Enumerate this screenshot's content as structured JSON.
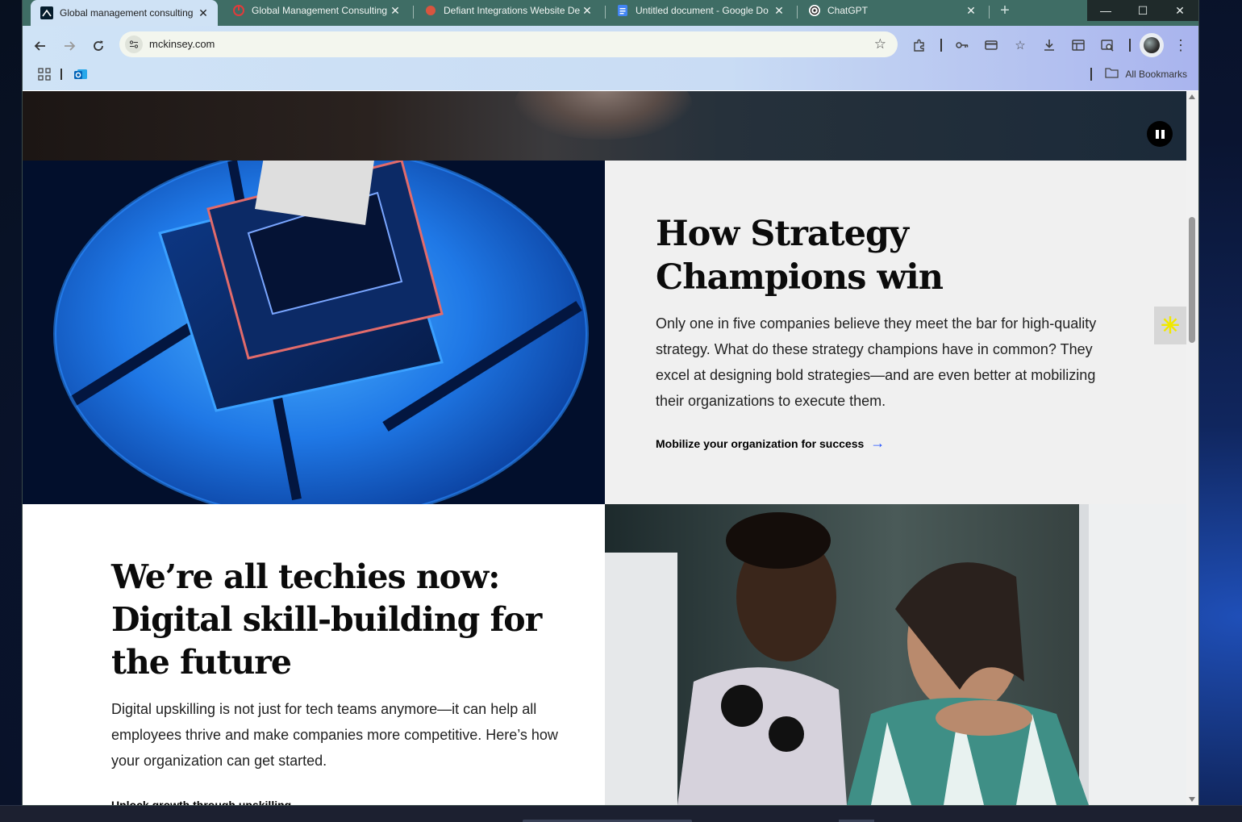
{
  "browser": {
    "tabs": [
      {
        "title": "Global management consulting",
        "icon": "mckinsey-icon",
        "active": true
      },
      {
        "title": "Global Management Consulting",
        "icon": "red-ring-icon",
        "active": false
      },
      {
        "title": "Defiant Integrations Website De",
        "icon": "defiant-icon",
        "active": false
      },
      {
        "title": "Untitled document - Google Do",
        "icon": "google-docs-icon",
        "active": false
      },
      {
        "title": "ChatGPT",
        "icon": "chatgpt-icon",
        "active": false
      }
    ],
    "url": "mckinsey.com",
    "bookmarks_label": "All Bookmarks"
  },
  "page": {
    "feature1": {
      "title": "How Strategy Champions win",
      "body": "Only one in five companies believe they meet the bar for high-quality strategy. What do these strategy champions have in common? They excel at designing bold strategies—and are even better at mobilizing their organizations to execute them.",
      "link": "Mobilize your organization for success"
    },
    "feature2": {
      "title": "We’re all techies now: Digital skill-building for the future",
      "body": "Digital upskilling is not just for tech teams anymore—it can help all employees thrive and make companies more competitive. Here’s how your organization can get started.",
      "link": "Unlock growth through upskilling"
    }
  },
  "colors": {
    "accent_link": "#2251ff",
    "panel_grey": "#f0f0f0",
    "tabstrip": "#3f6d65"
  }
}
